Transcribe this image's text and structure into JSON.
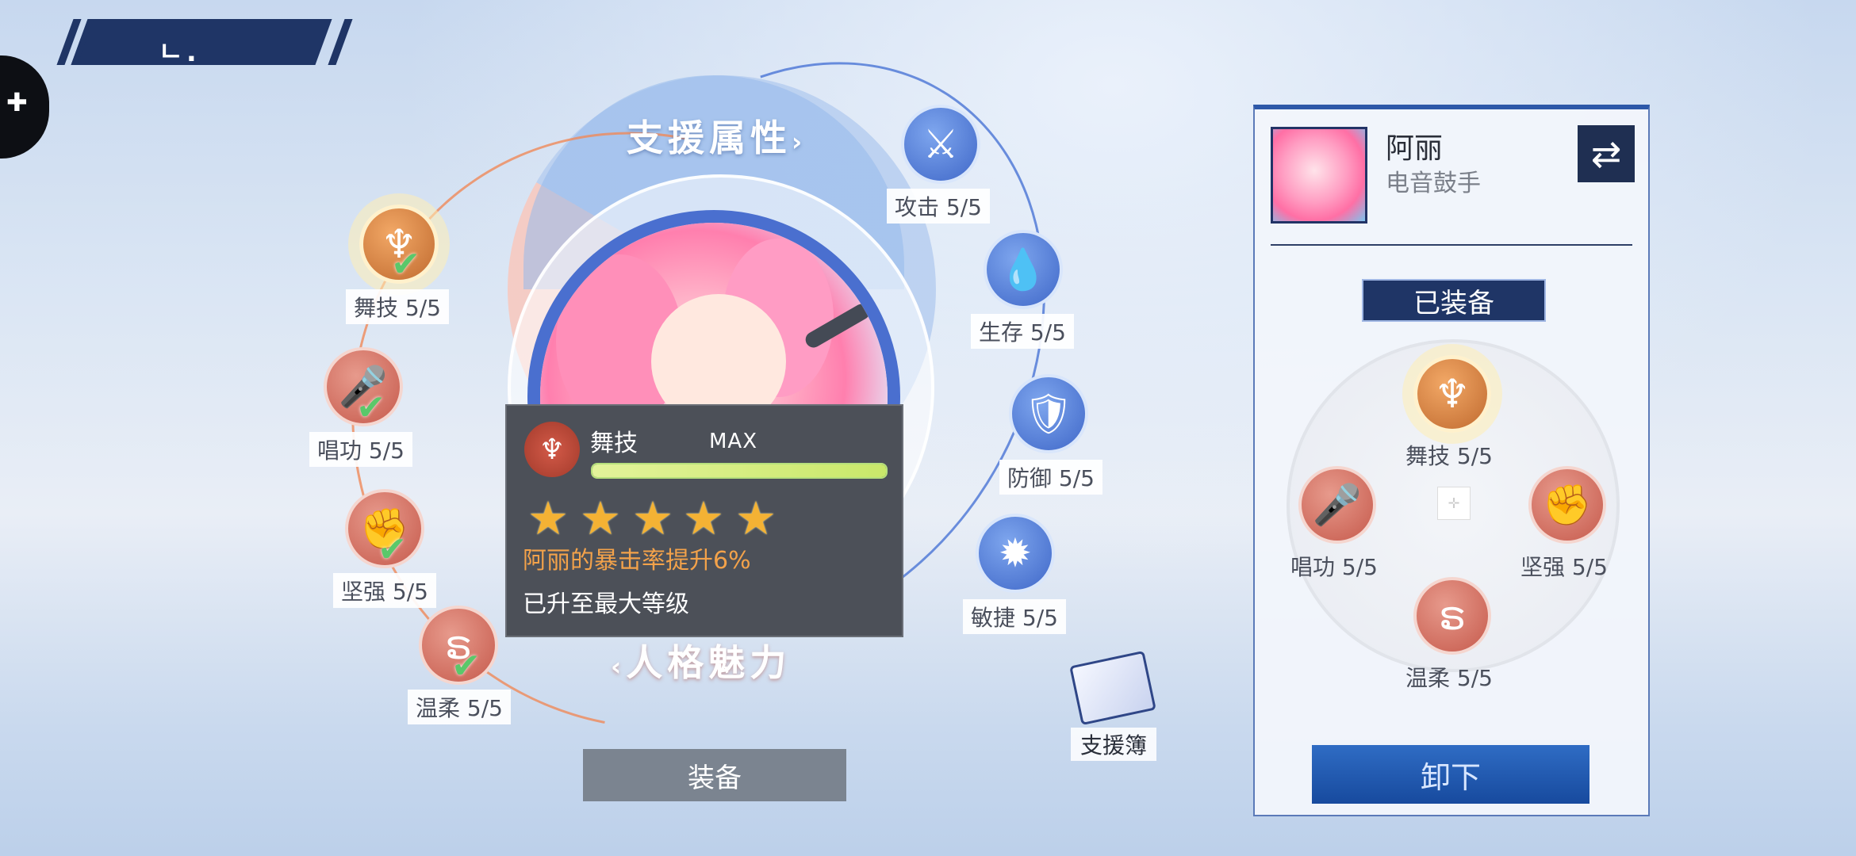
{
  "header": {
    "back_glyph": "ㄴ."
  },
  "wheel": {
    "title_top": "支援属性",
    "title_top_arrow": "›",
    "title_bottom": "人格魅力",
    "title_bottom_arrow": "‹"
  },
  "skills_left": [
    {
      "name": "舞技",
      "level": "舞技 5/5",
      "icon": "dance-icon"
    },
    {
      "name": "唱功",
      "level": "唱功 5/5",
      "icon": "microphone-icon"
    },
    {
      "name": "坚强",
      "level": "坚强 5/5",
      "icon": "fist-icon"
    },
    {
      "name": "温柔",
      "level": "温柔 5/5",
      "icon": "swirl-icon"
    }
  ],
  "skills_right": [
    {
      "name": "攻击",
      "level": "攻击 5/5",
      "icon": "crossed-swords-icon"
    },
    {
      "name": "生存",
      "level": "生存 5/5",
      "icon": "droplet-icon"
    },
    {
      "name": "防御",
      "level": "防御 5/5",
      "icon": "shield-icon"
    },
    {
      "name": "敏捷",
      "level": "敏捷 5/5",
      "icon": "sparkle-icon"
    }
  ],
  "tooltip": {
    "skill_name": "舞技",
    "max_label": "MAX",
    "progress": 1.0,
    "stars": 5,
    "description": "阿丽的暴击率提升6%",
    "note": "已升至最大等级"
  },
  "equip_button": "装备",
  "support_book": "支援簿",
  "panel": {
    "character_name": "阿丽",
    "character_role": "电音鼓手",
    "equipped_tag": "已装备",
    "equipped_skills": [
      {
        "level": "舞技 5/5"
      },
      {
        "level": "唱功 5/5"
      },
      {
        "level": "坚强 5/5"
      },
      {
        "level": "温柔 5/5"
      }
    ],
    "unequip_button": "卸下"
  },
  "colors": {
    "navy": "#1f3566",
    "blue_node": "#3f67c8",
    "red_node": "#c65a4c",
    "orange_node": "#c06a2f",
    "tooltip_bg": "#4c5058",
    "tooltip_highlight": "#f3a24a",
    "star": "#f4b234",
    "check": "#5ac86a"
  }
}
